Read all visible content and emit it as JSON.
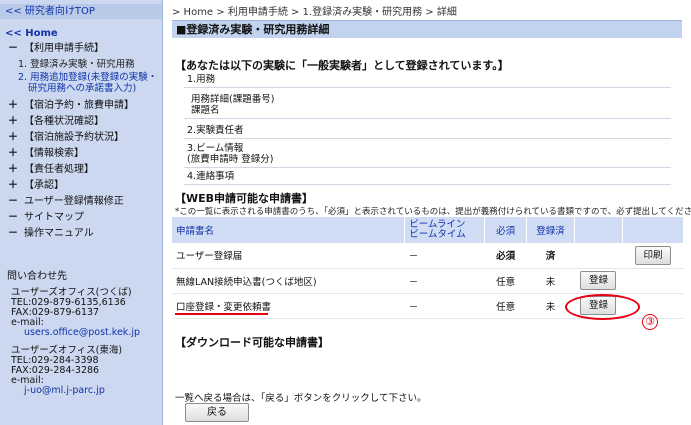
{
  "sidebar": {
    "top_link": "<< 研究者向けTOP",
    "home_link": "<< Home",
    "menu": [
      {
        "mark": "－",
        "label": "【利用申請手続】"
      },
      {
        "mark": "＋",
        "label": "【宿泊予約・旅費申請】"
      },
      {
        "mark": "＋",
        "label": "【各種状況確認】"
      },
      {
        "mark": "＋",
        "label": "【宿泊施設予約状況】"
      },
      {
        "mark": "＋",
        "label": "【情報検索】"
      },
      {
        "mark": "＋",
        "label": "【責任者処理】"
      },
      {
        "mark": "＋",
        "label": "【承認】"
      },
      {
        "mark": "－",
        "label": "ユーザー登録情報修正"
      },
      {
        "mark": "－",
        "label": "サイトマップ"
      },
      {
        "mark": "－",
        "label": "操作マニュアル"
      }
    ],
    "sub_items": [
      {
        "label": "1. 登録済み実験・研究用務"
      },
      {
        "label_line1": "2. 用務追加登録(未登録の実験・",
        "label_line2": "研究用務への承諾書入力)"
      }
    ],
    "contact": {
      "title": "問い合わせ先",
      "office1": {
        "name": "ユーザーズオフィス(つくば)",
        "tel": "TEL:029-879-6135,6136",
        "fax": "FAX:029-879-6137",
        "email_label": "e-mail:",
        "email": "users.office@post.kek.jp"
      },
      "office2": {
        "name": "ユーザーズオフィス(東海)",
        "tel": "TEL:029-284-3398",
        "fax": "FAX:029-284-3286",
        "email_label": "e-mail:",
        "email": "j-uo@ml.j-parc.jp"
      }
    }
  },
  "breadcrumb": "> Home > 利用申請手続 > 1.登録済み実験・研究用務 > 詳細",
  "page_title": "■登録済み実験・研究用務詳細",
  "notice": "【あなたは以下の実験に「一般実験者」として登録されています。】",
  "info": {
    "row1": "1.用務",
    "row2_line1": "用務詳細(課題番号)",
    "row2_line2": "課題名",
    "row3": "2.実験責任者",
    "row4_line1": "3.ビーム情報",
    "row4_line2": "(旅費申請時 登録分)",
    "row5": "4.連絡事項"
  },
  "web_section": {
    "title": "【WEB申請可能な申請書】",
    "note": "*この一覧に表示される申請書のうち、「必須」と表示されているものは、提出が義務付けられている書類ですので、必ず提出してください。",
    "headers": {
      "name": "申請書名",
      "beam_line1": "ビームライン",
      "beam_line2": "ビームタイム",
      "required": "必須",
      "registered": "登録済"
    },
    "rows": [
      {
        "name": "ユーザー登録届",
        "beam": "－",
        "required": "必須",
        "registered": "済",
        "button": "",
        "print": "印刷"
      },
      {
        "name": "無線LAN接続申込書(つくば地区)",
        "beam": "－",
        "required": "任意",
        "registered": "未",
        "button": "登録",
        "print": ""
      },
      {
        "name": "口座登録・変更依頼書",
        "beam": "－",
        "required": "任意",
        "registered": "未",
        "button": "登録",
        "print": ""
      }
    ],
    "annotation_number": "③"
  },
  "download_section": {
    "title": "【ダウンロード可能な申請書】"
  },
  "back_note": "一覧へ戻る場合は、「戻る」ボタンをクリックして下さい。",
  "back_button": "戻る",
  "colors": {
    "sidebar_bg": "#cbd8f0",
    "title_bar": "#c2d3ef",
    "link": "#1133aa",
    "annotation_red": "#e60012"
  }
}
